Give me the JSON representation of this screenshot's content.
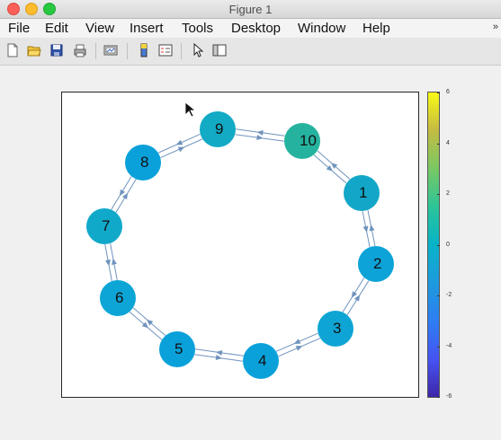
{
  "window": {
    "title": "Figure 1"
  },
  "menu": {
    "items": [
      "File",
      "Edit",
      "View",
      "Insert",
      "Tools",
      "Desktop",
      "Window",
      "Help"
    ],
    "overflow_icon": "chevron-right-icon"
  },
  "toolbar": {
    "tools": [
      "new-figure-icon",
      "open-file-icon",
      "save-icon",
      "print-icon",
      "link-plot-icon",
      "insert-colorbar-icon",
      "insert-legend-icon",
      "edit-plot-icon",
      "show-plot-tools-icon"
    ]
  },
  "colorbar": {
    "ticks": [
      "6",
      "4",
      "2",
      "0",
      "-2",
      "-4",
      "-6"
    ],
    "limits": [
      -6,
      6
    ]
  },
  "graph": {
    "nodes": [
      {
        "label": "1",
        "color": "#12a7c8"
      },
      {
        "label": "2",
        "color": "#0da3d8"
      },
      {
        "label": "3",
        "color": "#0ea5d4"
      },
      {
        "label": "4",
        "color": "#0aa1da"
      },
      {
        "label": "5",
        "color": "#0aa1da"
      },
      {
        "label": "6",
        "color": "#0da5d6"
      },
      {
        "label": "7",
        "color": "#11a9ca"
      },
      {
        "label": "8",
        "color": "#0aa1da"
      },
      {
        "label": "9",
        "color": "#12aac4"
      },
      {
        "label": "10",
        "color": "#25b39f"
      }
    ],
    "edge_color": "#6f93bd"
  }
}
